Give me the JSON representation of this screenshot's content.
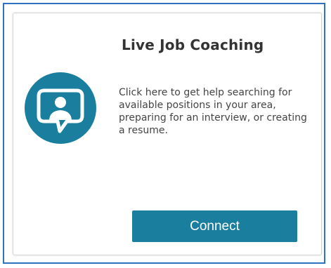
{
  "card": {
    "title": "Live Job Coaching",
    "description": "Click here to get help searching for available positions in your area, preparing for an interview, or creating a resume.",
    "icon": "person-chat-bubble-icon",
    "connect_label": "Connect"
  },
  "colors": {
    "accent": "#1a7f9e",
    "frame_border": "#2e72c0",
    "title_text": "#333333",
    "body_text": "#444444"
  }
}
